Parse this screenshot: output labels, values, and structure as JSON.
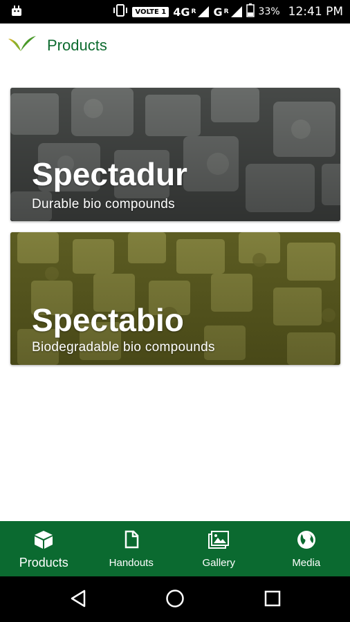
{
  "status_bar": {
    "volte": "VOLTE 1",
    "signal_1": "4G",
    "signal_1_sup": "R",
    "signal_2": "G",
    "signal_2_sup": "R",
    "battery": "33%",
    "time": "12:41 PM",
    "icons": [
      "android-icon",
      "vibrate-icon",
      "signal-icon",
      "battery-icon"
    ]
  },
  "app_bar": {
    "title": "Products",
    "logo": "leaf-logo"
  },
  "cards": [
    {
      "title": "Spectadur",
      "subtitle": "Durable bio compounds",
      "tint": "#4f5250"
    },
    {
      "title": "Spectabio",
      "subtitle": "Biodegradable bio compounds",
      "tint": "#6b6a2c"
    }
  ],
  "bottom_nav": {
    "items": [
      {
        "label": "Products",
        "icon": "cube-icon",
        "active": true
      },
      {
        "label": "Handouts",
        "icon": "document-icon",
        "active": false
      },
      {
        "label": "Gallery",
        "icon": "image-icon",
        "active": false
      },
      {
        "label": "Media",
        "icon": "globe-icon",
        "active": false
      }
    ]
  },
  "colors": {
    "brand_green": "#0b6a30",
    "title_green": "#0d6b2f",
    "logo_yellow": "#c9b22a",
    "logo_green": "#4a9a2a"
  },
  "system_nav": [
    "back-icon",
    "home-icon",
    "recents-icon"
  ]
}
